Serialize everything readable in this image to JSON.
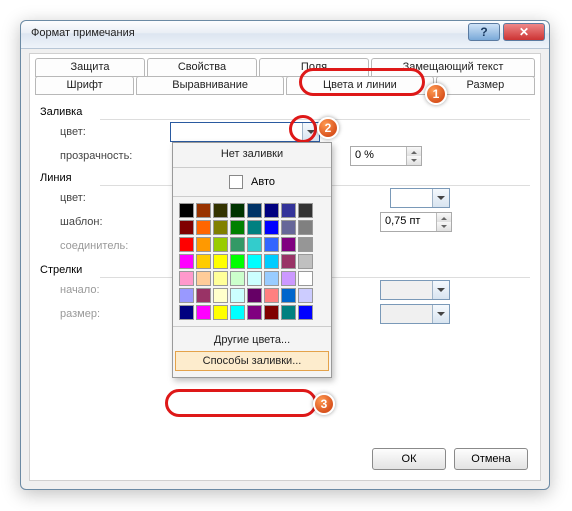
{
  "title": "Формат примечания",
  "tabs_row1": [
    "Защита",
    "Свойства",
    "Поля",
    "Замещающий текст"
  ],
  "tabs_row2": [
    "Шрифт",
    "Выравнивание",
    "Цвета и линии",
    "Размер"
  ],
  "groups": {
    "fill": "Заливка",
    "line": "Линия",
    "arrows": "Стрелки"
  },
  "labels": {
    "color": "цвет:",
    "transparency": "прозрачность:",
    "lcolor": "цвет:",
    "template": "шаблон:",
    "connector": "соединитель:",
    "start": "начало:",
    "size": "размер:"
  },
  "values": {
    "transparency": "0 %",
    "width": "0,75 пт"
  },
  "popup": {
    "no_fill": "Нет заливки",
    "auto": "Авто",
    "more_colors": "Другие цвета...",
    "fill_effects": "Способы заливки..."
  },
  "swatches": [
    "#000000",
    "#993300",
    "#333300",
    "#003300",
    "#003366",
    "#000080",
    "#333399",
    "#333333",
    "#800000",
    "#ff6600",
    "#808000",
    "#008000",
    "#008080",
    "#0000ff",
    "#666699",
    "#808080",
    "#ff0000",
    "#ff9900",
    "#99cc00",
    "#339966",
    "#33cccc",
    "#3366ff",
    "#800080",
    "#969696",
    "#ff00ff",
    "#ffcc00",
    "#ffff00",
    "#00ff00",
    "#00ffff",
    "#00ccff",
    "#993366",
    "#c0c0c0",
    "#ff99cc",
    "#ffcc99",
    "#ffff99",
    "#ccffcc",
    "#ccffff",
    "#99ccff",
    "#cc99ff",
    "#ffffff",
    "#9999ff",
    "#993366",
    "#ffffcc",
    "#ccffff",
    "#660066",
    "#ff8080",
    "#0066cc",
    "#ccccff",
    "#000080",
    "#ff00ff",
    "#ffff00",
    "#00ffff",
    "#800080",
    "#800000",
    "#008080",
    "#0000ff"
  ],
  "buttons": {
    "ok": "ОК",
    "cancel": "Отмена"
  },
  "badges": {
    "b1": "1",
    "b2": "2",
    "b3": "3"
  }
}
